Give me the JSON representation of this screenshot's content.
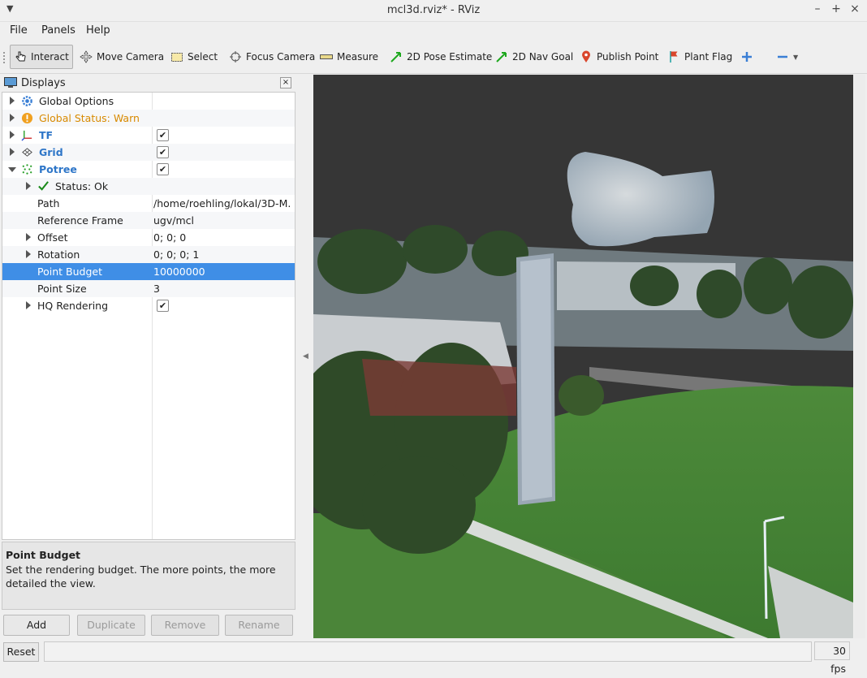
{
  "window": {
    "title": "mcl3d.rviz* - RViz"
  },
  "menu": [
    "File",
    "Panels",
    "Help"
  ],
  "toolbar": {
    "tools": [
      {
        "label": "Interact",
        "icon": "hand-cursor-icon",
        "active": true
      },
      {
        "label": "Move Camera",
        "icon": "move-camera-icon"
      },
      {
        "label": "Select",
        "icon": "select-box-icon"
      },
      {
        "label": "Focus Camera",
        "icon": "focus-camera-icon"
      },
      {
        "label": "Measure",
        "icon": "ruler-icon"
      },
      {
        "label": "2D Pose Estimate",
        "icon": "green-arrow-icon"
      },
      {
        "label": "2D Nav Goal",
        "icon": "green-arrow-icon"
      },
      {
        "label": "Publish Point",
        "icon": "map-pin-icon"
      },
      {
        "label": "Plant Flag",
        "icon": "flag-icon"
      }
    ]
  },
  "displays": {
    "title": "Displays",
    "rows": [
      {
        "label": "Global Options",
        "value": ""
      },
      {
        "label": "Global Status: Warn",
        "value": ""
      },
      {
        "label": "TF",
        "value": "",
        "checked": true
      },
      {
        "label": "Grid",
        "value": "",
        "checked": true
      },
      {
        "label": "Potree",
        "value": "",
        "checked": true
      },
      {
        "label": "Status: Ok",
        "value": ""
      },
      {
        "label": "Path",
        "value": "/home/roehling/lokal/3D-M..."
      },
      {
        "label": "Reference Frame",
        "value": "ugv/mcl"
      },
      {
        "label": "Offset",
        "value": "0; 0; 0"
      },
      {
        "label": "Rotation",
        "value": "0; 0; 0; 1"
      },
      {
        "label": "Point Budget",
        "value": "10000000"
      },
      {
        "label": "Point Size",
        "value": "3"
      },
      {
        "label": "HQ Rendering",
        "value": "",
        "checked": true
      }
    ]
  },
  "description": {
    "title": "Point Budget",
    "text": "Set the rendering budget. The more points, the more detailed the view."
  },
  "buttons": {
    "add": "Add",
    "duplicate": "Duplicate",
    "remove": "Remove",
    "rename": "Rename"
  },
  "status": {
    "reset": "Reset",
    "fps": "30 fps"
  },
  "colors": {
    "selection": "#3f8ee6",
    "link_blue": "#2e76c8",
    "warn": "#d88a00"
  }
}
